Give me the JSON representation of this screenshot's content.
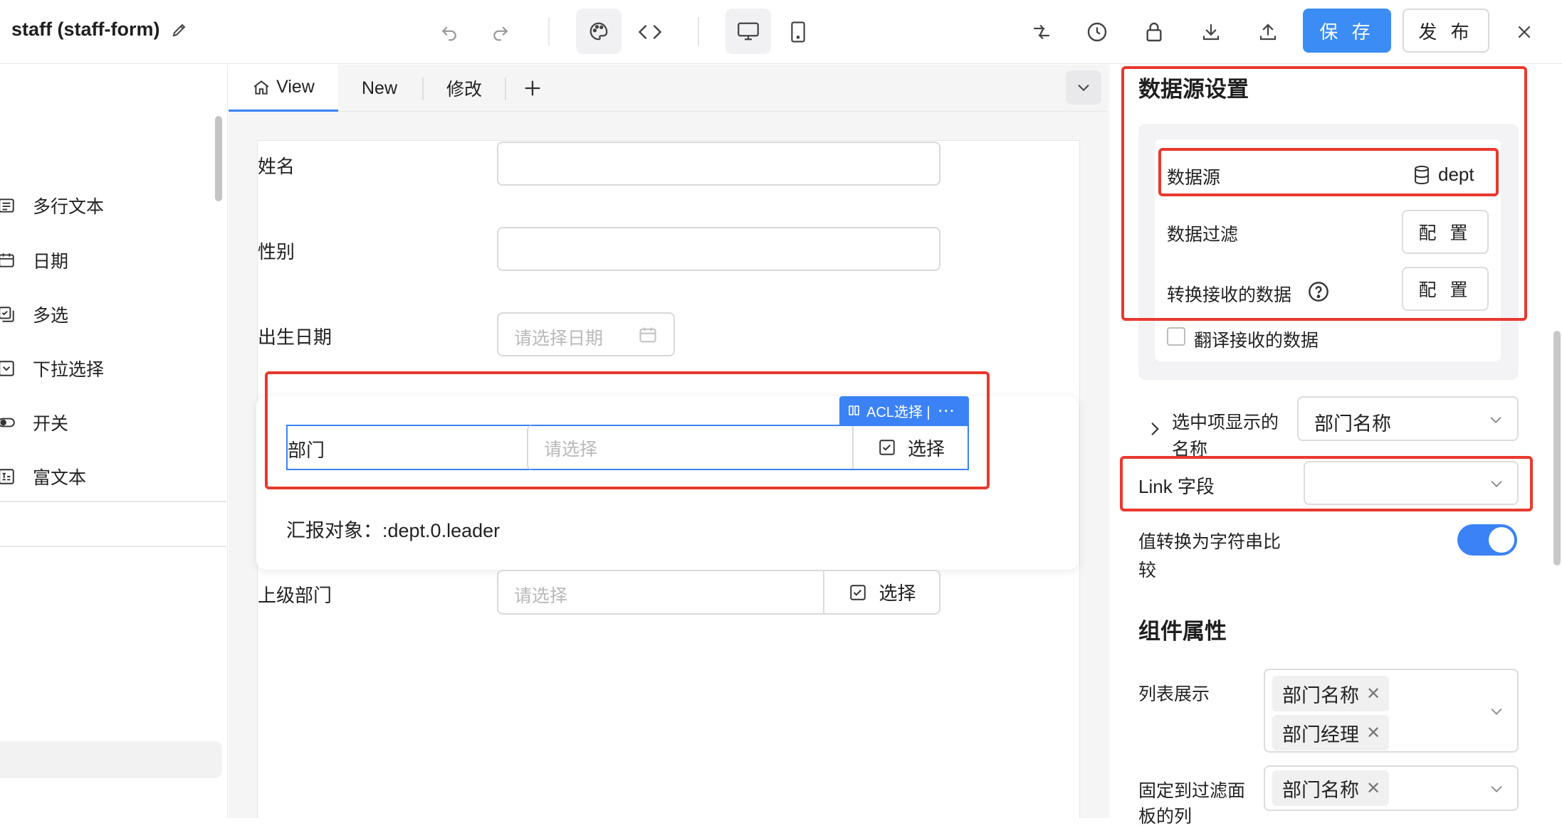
{
  "app": {
    "title": "staff (staff-form)"
  },
  "toolbar": {
    "save_label": "保 存",
    "publish_label": "发 布",
    "icons": [
      "undo-icon",
      "redo-icon",
      "palette-icon",
      "code-icon",
      "desktop-icon",
      "mobile-icon",
      "collapse-arrows-icon",
      "history-icon",
      "lock-icon",
      "download-icon",
      "upload-icon",
      "close-icon"
    ]
  },
  "sidebar": {
    "items": [
      {
        "label": "多行文本",
        "icon": "textarea-icon"
      },
      {
        "label": "日期",
        "icon": "calendar-icon"
      },
      {
        "label": "多选",
        "icon": "multi-select-icon"
      },
      {
        "label": "下拉选择",
        "icon": "dropdown-icon"
      },
      {
        "label": "开关",
        "icon": "switch-icon"
      },
      {
        "label": "富文本",
        "icon": "rich-text-icon"
      }
    ]
  },
  "tabs": [
    {
      "label": "View",
      "active": true,
      "icon": "home-icon"
    },
    {
      "label": "New",
      "active": false
    },
    {
      "label": "修改",
      "active": false
    }
  ],
  "form": {
    "name_label": "姓名",
    "gender_label": "性别",
    "birthdate_label": "出生日期",
    "birthdate_placeholder": "请选择日期",
    "dept_label": "部门",
    "dept_placeholder": "请选择",
    "dept_select_label": "选择",
    "acl_badge": "ACL选择 |",
    "report_text": "汇报对象：:dept.0.leader",
    "parent_dept_label": "上级部门",
    "parent_dept_placeholder": "请选择",
    "parent_dept_select_label": "选择"
  },
  "panel": {
    "datasource_title": "数据源设置",
    "datasource_label": "数据源",
    "datasource_value": "dept",
    "filter_label": "数据过滤",
    "filter_button": "配 置",
    "transform_label": "转换接收的数据",
    "transform_button": "配 置",
    "translate_label": "翻译接收的数据",
    "translate_checked": false,
    "display_name_label_1": "选中项显示的",
    "display_name_label_2": "名称",
    "display_name_value": "部门名称",
    "link_field_label": "Link 字段",
    "link_field_value": "",
    "compare_label_1": "值转换为字符串比",
    "compare_label_2": "较",
    "compare_on": true,
    "component_title": "组件属性",
    "list_display_label": "列表展示",
    "list_display_tags": [
      "部门名称",
      "部门经理"
    ],
    "pin_filter_label_1": "固定到过滤面",
    "pin_filter_label_2": "板的列",
    "pin_filter_tags": [
      "部门名称"
    ]
  },
  "colors": {
    "accent": "#3b82f6",
    "save_button": "#3b8cf5",
    "highlight": "#e8392e",
    "switch_on": "#3b82f6"
  }
}
